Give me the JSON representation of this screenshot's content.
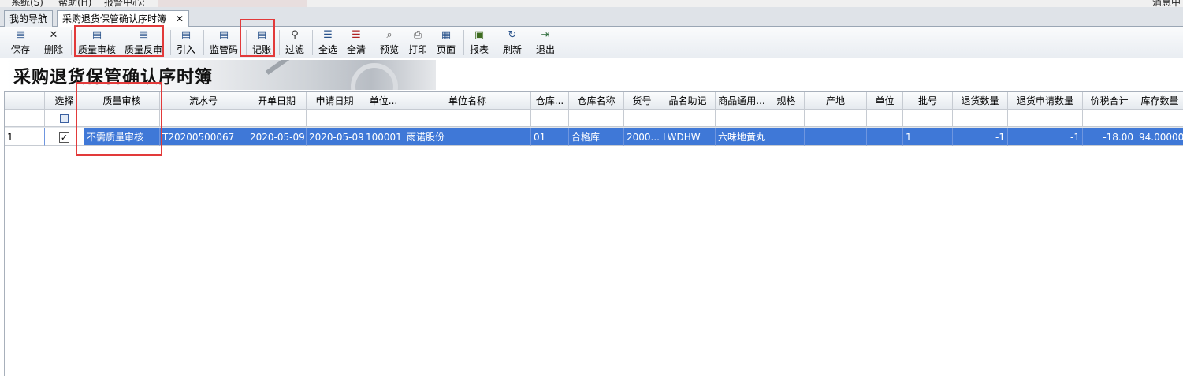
{
  "menu": {
    "items": [
      "系统(S)",
      "帮助(H)",
      "报警中心:"
    ],
    "right": "消息中心"
  },
  "tabs": [
    {
      "label": "我的导航"
    },
    {
      "label": "采购退货保管确认序时簿",
      "close": "✕"
    }
  ],
  "toolbar": [
    {
      "label": "保存",
      "icon": "save-icon"
    },
    {
      "label": "删除",
      "icon": "delete-icon"
    },
    {
      "label": "质量审核",
      "icon": "quality-audit-icon"
    },
    {
      "label": "质量反审",
      "icon": "quality-unaudit-icon"
    },
    {
      "label": "引入",
      "icon": "import-icon"
    },
    {
      "label": "监管码",
      "icon": "supervision-code-icon"
    },
    {
      "label": "记账",
      "icon": "bookkeeping-icon"
    },
    {
      "label": "过滤",
      "icon": "filter-icon"
    },
    {
      "label": "全选",
      "icon": "select-all-icon"
    },
    {
      "label": "全清",
      "icon": "clear-all-icon"
    },
    {
      "label": "预览",
      "icon": "preview-icon"
    },
    {
      "label": "打印",
      "icon": "print-icon"
    },
    {
      "label": "页面",
      "icon": "page-icon"
    },
    {
      "label": "报表",
      "icon": "report-icon"
    },
    {
      "label": "刷新",
      "icon": "refresh-icon"
    },
    {
      "label": "退出",
      "icon": "exit-icon"
    }
  ],
  "banner": {
    "title": "采购退货保管确认序时簿"
  },
  "table": {
    "columns": [
      "",
      "选择",
      "质量审核",
      "流水号",
      "开单日期",
      "申请日期",
      "单位...",
      "单位名称",
      "仓库...",
      "仓库名称",
      "货号",
      "品名助记",
      "商品通用...",
      "规格",
      "产地",
      "单位",
      "批号",
      "退货数量",
      "退货申请数量",
      "价税合计",
      "库存数量"
    ],
    "rows": [
      {
        "row_no": "1",
        "checked": true,
        "cells": [
          "不需质量审核",
          "T20200500067",
          "2020-05-09",
          "2020-05-09",
          "100001",
          "雨诺股份",
          "01",
          "合格库",
          "2000...",
          "LWDHW",
          "六味地黄丸",
          "",
          "",
          "",
          "1",
          "-1",
          "-1",
          "-18.00",
          "94.00000"
        ]
      }
    ]
  },
  "colors": {
    "selection": "#3f78d7",
    "highlight_box": "#e23a3a"
  }
}
